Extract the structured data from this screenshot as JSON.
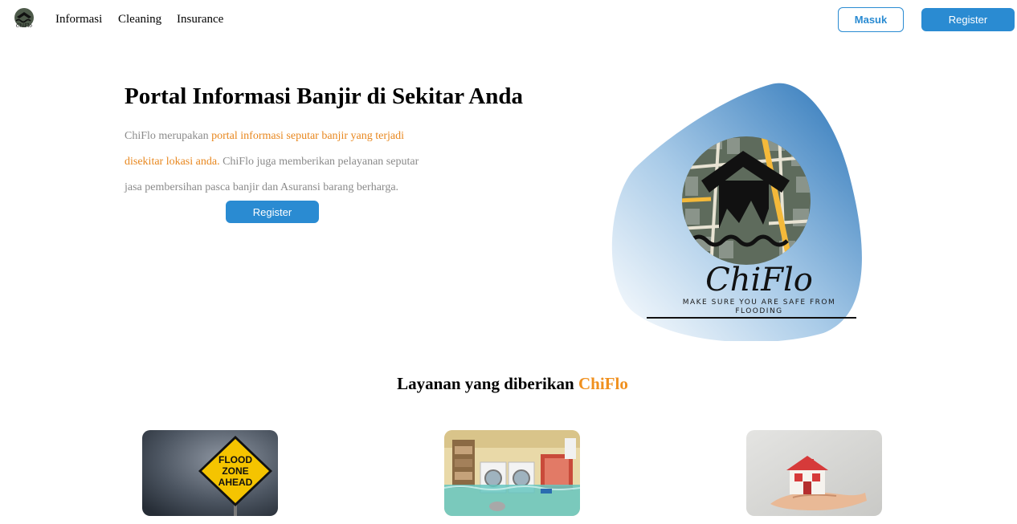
{
  "nav": {
    "logo_icon": "chiflo-logo-icon",
    "links": [
      "Informasi",
      "Cleaning",
      "Insurance"
    ],
    "login_label": "Masuk",
    "register_label": "Register"
  },
  "hero": {
    "title": "Portal Informasi Banjir di Sekitar Anda",
    "desc_part1": "ChiFlo merupakan ",
    "desc_highlight1": "portal informasi seputar banjir yang terjadi",
    "desc_highlight2": "disekitar lokasi anda.",
    "desc_part2": " ChiFlo juga memberikan pelayanan seputar jasa pembersihan pasca banjir dan Asuransi barang berharga.",
    "register_label": "Register",
    "logo_wordmark": "ChiFlo",
    "logo_tagline_line1": "MAKE SURE YOU ARE SAFE FROM",
    "logo_tagline_line2": "FLOODING"
  },
  "services": {
    "title_prefix": "Layanan yang diberikan ",
    "title_brand": "ChiFlo",
    "cards": [
      {
        "icon": "flood-warning-sign-image",
        "sign_line1": "FLOOD",
        "sign_line2": "ZONE",
        "sign_line3": "AHEAD"
      },
      {
        "icon": "flooded-laundry-room-image"
      },
      {
        "icon": "house-in-hand-image"
      }
    ]
  },
  "colors": {
    "accent_blue": "#2a8bd2",
    "highlight_orange": "#e8871e",
    "brand_orange": "#f0901e",
    "muted_text": "#8a8a8a"
  }
}
